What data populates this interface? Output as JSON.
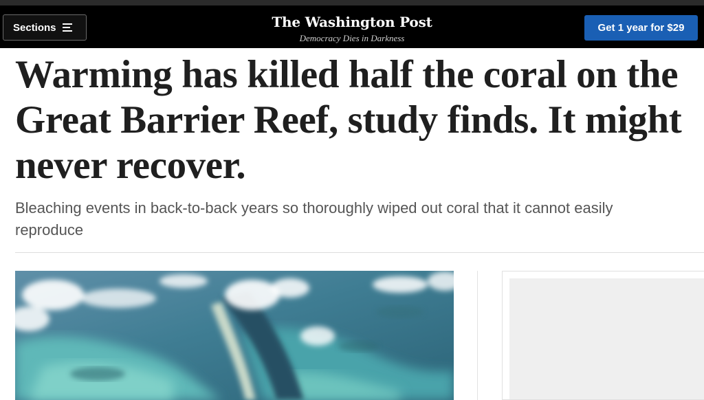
{
  "header": {
    "sections_label": "Sections",
    "hamburger_icon": "hamburger-menu-icon",
    "logo_text": "The Washington Post",
    "tagline": "Democracy Dies in Darkness",
    "subscribe_label": "Get 1 year for $29",
    "colors": {
      "background": "#000000",
      "subscribe_button": "#1a5fb4"
    }
  },
  "article": {
    "headline": "Warming has killed half the coral on the\nGreat Barrier Reef, study finds. It might\nnever recover.",
    "subheadline": "Bleaching events in back-to-back years so thoroughly wiped out coral that it cannot easily\nreproduce"
  }
}
